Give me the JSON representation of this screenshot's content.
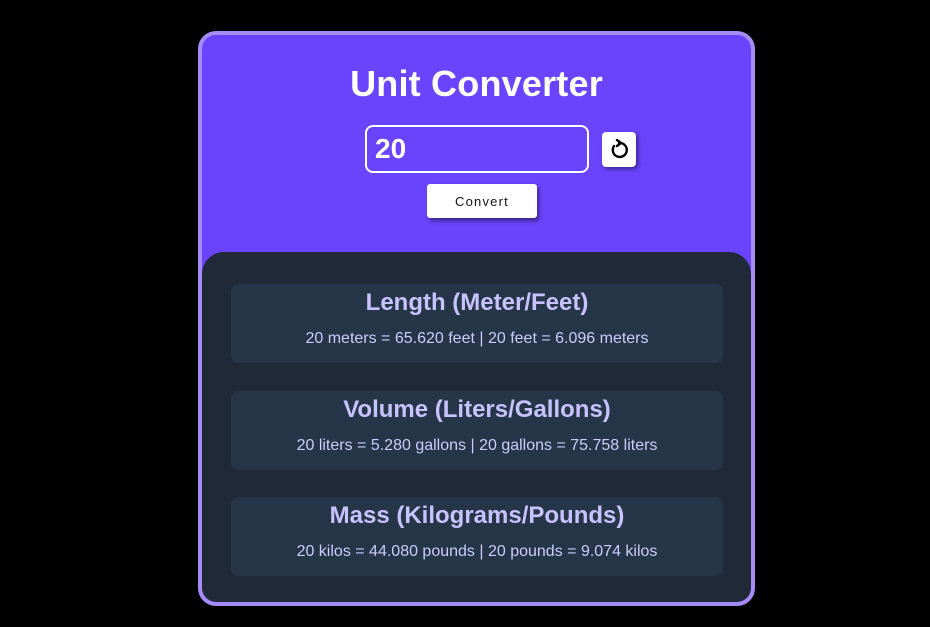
{
  "app": {
    "title": "Unit Converter"
  },
  "input": {
    "value": "20"
  },
  "buttons": {
    "reset_icon": "↻",
    "convert_label": "Convert"
  },
  "colors": {
    "page_background": "#000000",
    "card_accent": "#6a44fd",
    "card_border": "#a58bf6",
    "results_background": "#1f2937",
    "result_box": "#263548",
    "result_title": "#c7c3ff"
  },
  "results": [
    {
      "title": "Length (Meter/Feet)",
      "text": "20 meters = 65.620 feet | 20 feet = 6.096 meters"
    },
    {
      "title": "Volume (Liters/Gallons)",
      "text": "20 liters = 5.280 gallons | 20 gallons = 75.758 liters"
    },
    {
      "title": "Mass (Kilograms/Pounds)",
      "text": "20 kilos = 44.080 pounds | 20 pounds = 9.074 kilos"
    }
  ]
}
